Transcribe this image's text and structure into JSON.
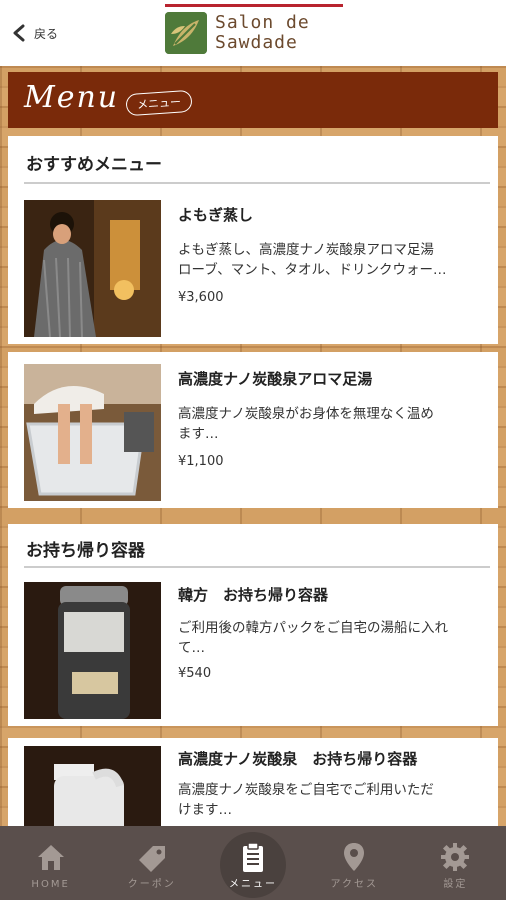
{
  "header": {
    "back_label": "戻る",
    "logo_line1": "Salon de",
    "logo_line2": "Sawdade"
  },
  "banner": {
    "title": "Menu",
    "subtitle": "メニュー"
  },
  "sections": [
    {
      "title": "おすすめメニュー",
      "items": [
        {
          "name": "よもぎ蒸し",
          "desc1": "よもぎ蒸し、高濃度ナノ炭酸泉アロマ足湯",
          "desc2": "ローブ、マント、タオル、ドリンクウォー…",
          "price": "¥3,600"
        },
        {
          "name": "高濃度ナノ炭酸泉アロマ足湯",
          "desc1": "高濃度ナノ炭酸泉がお身体を無理なく温め",
          "desc2": "ます…",
          "price": "¥1,100"
        }
      ]
    },
    {
      "title": "お持ち帰り容器",
      "items": [
        {
          "name": "韓方　お持ち帰り容器",
          "desc1": "ご利用後の韓方パックをご自宅の湯船に入れ",
          "desc2": "て…",
          "price": "¥540"
        },
        {
          "name": "高濃度ナノ炭酸泉　お持ち帰り容器",
          "desc1": "高濃度ナノ炭酸泉をご自宅でご利用いただ",
          "desc2": "けます…",
          "price": ""
        }
      ]
    }
  ],
  "tabs": [
    {
      "label": "HOME",
      "icon": "home-icon"
    },
    {
      "label": "クーポン",
      "icon": "coupon-tag-icon"
    },
    {
      "label": "メニュー",
      "icon": "clipboard-icon"
    },
    {
      "label": "アクセス",
      "icon": "map-pin-icon"
    },
    {
      "label": "設定",
      "icon": "gear-icon"
    }
  ],
  "active_tab": "メニュー",
  "colors": {
    "banner": "#7a2a0a",
    "tabbar": "#5a4f4c",
    "accent_red": "#b8232e"
  }
}
